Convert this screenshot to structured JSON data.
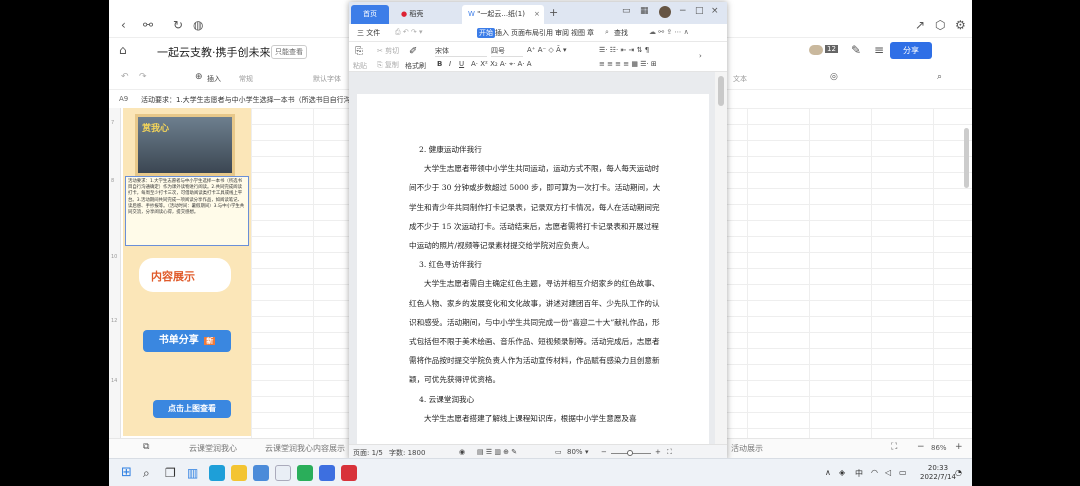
{
  "back_app": {
    "doc_title": "一起云支教·携手创未来",
    "readonly_badge": "只能查看",
    "share_label": "分享",
    "avatar_count": "12",
    "insert_label": "插入",
    "font_placeholder": "常规",
    "font_name_placeholder": "默认字体",
    "text_label": "文本",
    "cell_ref": "A9",
    "formula_text": "活动要求：1.大学生志愿者与中小学生选择一本书（所选书目自行沟通",
    "poster": {
      "photo_title": "赏我心",
      "text": "活动要求：1.大学生志愿者与中小学生选择一本书（所选书目自行沟通确定）作为课外读物进行阅读。2.共同完成阅读打卡，每周至少打卡三次，可借助阅读类打卡工具或线上平台。3.活动期间共同完成一项阅读分享作品，如阅读笔记、读后感、手抄报等。（活动时间：暑假期间）3.与中小学生共同交流，分享阅读心得，提交感想。",
      "content_show": "内容展示",
      "book_share": "书单分享",
      "new_tag": "新",
      "click_view": "点击上图查看"
    },
    "sheet_tabs": [
      "云课堂润我心",
      "云课堂润我心内容展示",
      "活动展示"
    ],
    "zoom": "86%"
  },
  "wps": {
    "tabs": {
      "home": "首页",
      "daoke": "稻壳",
      "doc": "\"一起云...纸(1)"
    },
    "menus": [
      "三 文件",
      "开始",
      "插入",
      "页面布局",
      "引用",
      "审阅",
      "视图",
      "章"
    ],
    "active_menu": "开始",
    "search": "查找",
    "ribbon": {
      "cut": "剪切",
      "copy": "复制",
      "paste": "粘贴",
      "format_painter": "格式刷",
      "font": "宋体",
      "size": "四号"
    },
    "body": {
      "h2": "2. 健康运动伴我行",
      "p2": "大学生志愿者带领中小学生共同运动，运动方式不限，每人每天运动时间不少于 30 分钟或步数超过 5000 步，即可算为一次打卡。活动期间，大学生和青少年共同制作打卡记录表，记录双方打卡情况，每人在活动期间完成不少于 15 次运动打卡。活动结束后，志愿者需将打卡记录表和开展过程中运动的照片/视频等记录素材提交给学院对应负责人。",
      "h3": "3. 红色寻访伴我行",
      "p3": "大学生志愿者需自主确定红色主题，寻访并相互介绍家乡的红色故事、红色人物、家乡的发展变化和文化故事，讲述对建团百年、少先队工作的认识和感受。活动期间，与中小学生共同完成一份“喜迎二十大”献礼作品，形式包括但不限于美术绘画、音乐作品、短视频录制等。活动完成后，志愿者需将作品按时提交学院负责人作为活动宣传材料，作品赋有感染力且创意新颖，可优先获得评优资格。",
      "h4": "4. 云课堂润我心",
      "p4": "大学生志愿者搭建了解线上课程知识库，根据中小学生意愿及喜"
    },
    "status": {
      "page": "页面: 1/5",
      "words": "字数: 1800",
      "zoom": "80%"
    }
  },
  "taskbar": {
    "tray": {
      "ime": "中",
      "time": "20:33",
      "date": "2022/7/14"
    }
  },
  "colors": {
    "accent": "#2f6fe6",
    "wps_blue": "#3c7de8",
    "poster_bg": "#fbe6b8"
  }
}
